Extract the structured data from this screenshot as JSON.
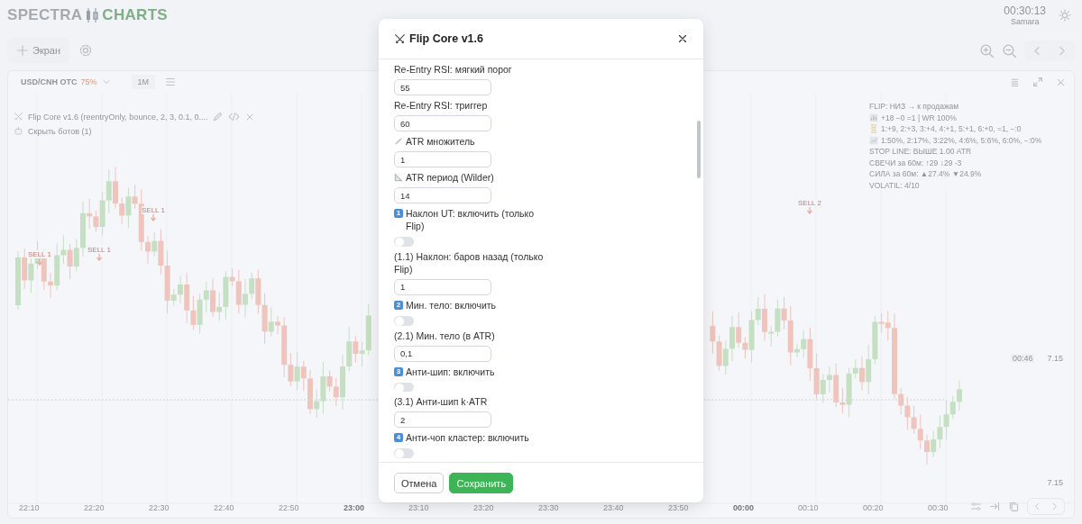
{
  "header": {
    "logo_left": "SPECTRA",
    "logo_right": "CHARTS",
    "clock": "00:30:13",
    "timezone": "Samara"
  },
  "toolbar": {
    "add_button": "Экран"
  },
  "chart": {
    "symbol": "USD/CNH OTC",
    "payout": "75%",
    "timeframe": "1M",
    "indicator": {
      "label": "Flip Core v1.6 (reentryOnly, bounce, 2, 3, 0.1, 0...."
    },
    "bots_toggle": "Скрыть ботов (1)",
    "info_lines": [
      {
        "kind": "plain",
        "text": "FLIP: НИЗ → к продажам"
      },
      {
        "kind": "bar",
        "text": "+18 −0 =1 | WR 100%"
      },
      {
        "kind": "hourglass",
        "text": "1:+9, 2:+3, 3:+4, 4:+1, 5:+1, 6:+0, =1, −:0"
      },
      {
        "kind": "trend",
        "text": "1:50%, 2:17%, 3:22%, 4:6%, 5:6%, 6:0%, −:0%"
      },
      {
        "kind": "plain",
        "text": "STOP LINE: ВЫШЕ 1.00 ATR"
      },
      {
        "kind": "plain",
        "text": "СВЕЧИ за 60м: ↑29 ↓29 -3"
      },
      {
        "kind": "plain",
        "text": "СИЛА за 60м: ▲27.4% ▼24.9%"
      },
      {
        "kind": "plain",
        "text": "VOLATIL: 4/10"
      }
    ],
    "signals": [
      "SELL 1",
      "SELL 1",
      "SELL 1",
      "SELL 2"
    ],
    "countdown": "00:46",
    "price": "7.15",
    "price_axis_label": "7.15",
    "time_labels": [
      {
        "text": "22:10",
        "major": false
      },
      {
        "text": "22:20",
        "major": false
      },
      {
        "text": "22:30",
        "major": false
      },
      {
        "text": "22:40",
        "major": false
      },
      {
        "text": "22:50",
        "major": false
      },
      {
        "text": "23:00",
        "major": true
      },
      {
        "text": "23:10",
        "major": false
      },
      {
        "text": "23:20",
        "major": false
      },
      {
        "text": "23:30",
        "major": false
      },
      {
        "text": "23:40",
        "major": false
      },
      {
        "text": "23:50",
        "major": false
      },
      {
        "text": "00:00",
        "major": true
      },
      {
        "text": "00:10",
        "major": false
      },
      {
        "text": "00:20",
        "major": false
      },
      {
        "text": "00:30",
        "major": false
      }
    ]
  },
  "dialog": {
    "title": "Flip Core v1.6",
    "fields": [
      {
        "kind": "number",
        "label": "Re-Entry RSI: мягкий порог",
        "value": "55"
      },
      {
        "kind": "number",
        "label": "Re-Entry RSI: триггер",
        "value": "60"
      },
      {
        "kind": "number",
        "label": "ATR множитель",
        "value": "1"
      },
      {
        "kind": "number",
        "label": "ATR период (Wilder)",
        "value": "14"
      },
      {
        "kind": "toggle",
        "badge": "1",
        "label": "Наклон UT: включить (только Flip)",
        "on": false
      },
      {
        "kind": "number",
        "label": "(1.1) Наклон: баров назад (только Flip)",
        "value": "1"
      },
      {
        "kind": "toggle",
        "badge": "2",
        "label": "Мин. тело: включить",
        "on": false
      },
      {
        "kind": "number",
        "label": "(2.1) Мин. тело (в ATR)",
        "value": "0,1"
      },
      {
        "kind": "toggle",
        "badge": "3",
        "label": "Анти-шип: включить",
        "on": false
      },
      {
        "kind": "number",
        "label": "(3.1) Анти-шип k·ATR",
        "value": "2"
      },
      {
        "kind": "toggle",
        "badge": "4",
        "label": "Анти-чоп кластер: включить",
        "on": false
      }
    ],
    "buttons": [
      {
        "kind": "secondary",
        "label": "Отмена"
      },
      {
        "kind": "primary",
        "label": "Сохранить"
      }
    ]
  }
}
